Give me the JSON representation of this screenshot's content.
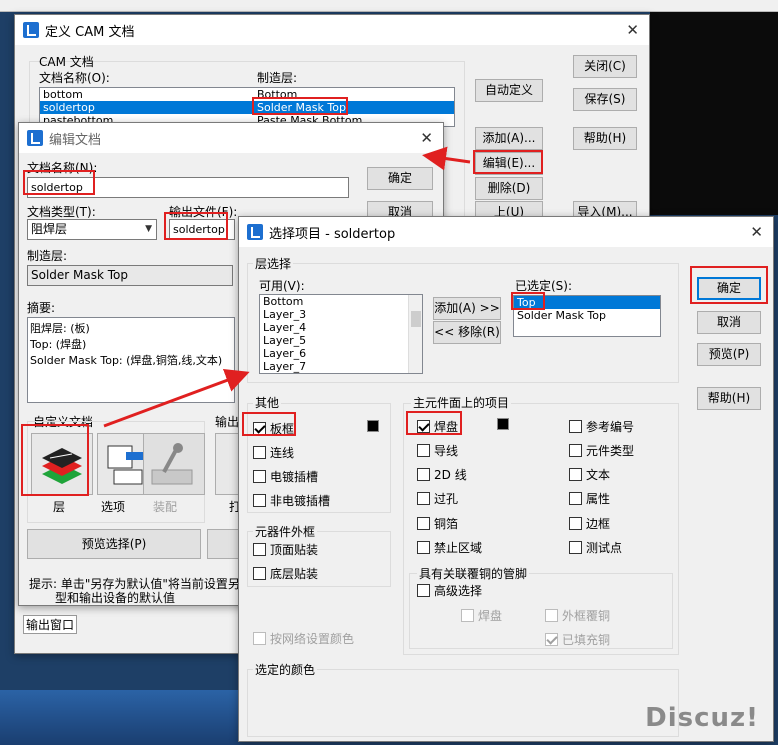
{
  "cam_window": {
    "title": "定义 CAM 文档",
    "group_label": "CAM 文档",
    "col_doc_name": "文档名称(O):",
    "col_layer": "制造层:",
    "rows": [
      {
        "name": "bottom",
        "layer": "Bottom"
      },
      {
        "name": "soldertop",
        "layer": "Solder Mask Top"
      },
      {
        "name": "pastebottom",
        "layer": "Paste Mask Bottom"
      }
    ],
    "buttons": {
      "auto_define": "自动定义",
      "close": "关闭(C)",
      "save": "保存(S)",
      "add": "添加(A)...",
      "help": "帮助(H)",
      "edit": "编辑(E)...",
      "delete": "删除(D)",
      "up": "上(U)",
      "import": "导入(M)..."
    },
    "output_window_label": "输出窗口"
  },
  "edit_window": {
    "title": "编辑文档",
    "doc_name_label": "文档名称(N):",
    "doc_name_value": "soldertop",
    "ok": "确定",
    "cancel": "取消",
    "doc_type_label": "文档类型(T):",
    "doc_type_value": "阻焊层",
    "output_file_label": "输出文件(F):",
    "output_file_value": "soldertop",
    "layer_label": "制造层:",
    "layer_value": "Solder Mask Top",
    "summary_label": "摘要:",
    "summary_lines": [
      "阻焊层: (板)",
      "Top: (焊盘)",
      "Solder Mask Top: (焊盘,铜箔,线,文本)"
    ],
    "custom_doc_label": "自定义文档",
    "output_label": "输出",
    "tool_layer": "层",
    "tool_options": "选项",
    "tool_assembly": "装配",
    "tool_print": "打",
    "preview_select": "预览选择(P)",
    "hint_line1": "提示: 单击\"另存为默认值\"将当前设置另存",
    "hint_line2": "型和输出设备的默认值"
  },
  "select_window": {
    "title": "选择项目 - soldertop",
    "layer_group": "层选择",
    "available_label": "可用(V):",
    "available_items": [
      "Bottom",
      "Layer_3",
      "Layer_4",
      "Layer_5",
      "Layer_6",
      "Layer_7"
    ],
    "add_btn": "添加(A) >>",
    "remove_btn": "<< 移除(R)",
    "selected_label": "已选定(S):",
    "selected_items": [
      "Top",
      "Solder Mask Top"
    ],
    "buttons": {
      "ok": "确定",
      "cancel": "取消",
      "preview": "预览(P)",
      "help": "帮助(H)"
    },
    "other_group": "其他",
    "other_items": [
      {
        "label": "板框",
        "checked": true
      },
      {
        "label": "连线",
        "checked": false
      },
      {
        "label": "电镀插槽",
        "checked": false
      },
      {
        "label": "非电镀插槽",
        "checked": false
      }
    ],
    "outline_group": "元器件外框",
    "outline_items": [
      {
        "label": "顶面贴装",
        "checked": false
      },
      {
        "label": "底层贴装",
        "checked": false
      }
    ],
    "net_color": "按网络设置颜色",
    "selected_color": "选定的颜色",
    "main_group": "主元件面上的项目",
    "main_left": [
      {
        "label": "焊盘",
        "checked": true
      },
      {
        "label": "导线",
        "checked": false
      },
      {
        "label": "2D 线",
        "checked": false
      },
      {
        "label": "过孔",
        "checked": false
      },
      {
        "label": "铜箔",
        "checked": false
      },
      {
        "label": "禁止区域",
        "checked": false
      }
    ],
    "main_right": [
      {
        "label": "参考编号",
        "checked": false
      },
      {
        "label": "元件类型",
        "checked": false
      },
      {
        "label": "文本",
        "checked": false
      },
      {
        "label": "属性",
        "checked": false
      },
      {
        "label": "边框",
        "checked": false
      },
      {
        "label": "测试点",
        "checked": false
      }
    ],
    "copper_group": "具有关联覆铜的管脚",
    "advanced": "高级选择",
    "pad": "焊盘",
    "outline_pour": "外框覆铜",
    "filled": "已填充铜"
  },
  "watermark": "Discuz!",
  "colors": {
    "accent": "#0078d7",
    "highlight": "#e02020"
  }
}
